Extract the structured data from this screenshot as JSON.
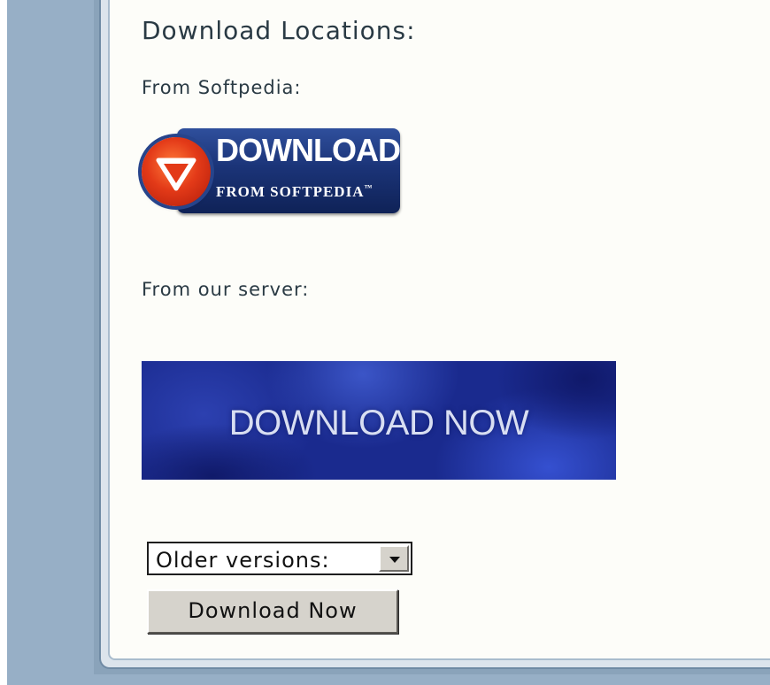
{
  "section": {
    "heading": "Download Locations:",
    "from_softpedia_label": "From Softpedia:",
    "from_server_label": "From our server:"
  },
  "softpedia_badge": {
    "line1": "DOWNLOAD",
    "line2": "FROM SOFTPEDIA",
    "trademark": "™"
  },
  "server_banner": {
    "text": "DOWNLOAD NOW"
  },
  "older_versions": {
    "selected": "Older versions:"
  },
  "download_button": {
    "label": "Download Now"
  },
  "colors": {
    "sidebar": "#97afc6",
    "panel_bg": "#fdfdf9",
    "badge_blue": "#1b3478",
    "badge_red": "#e33a18",
    "banner_blue": "#1a2a8e",
    "button_face": "#d6d3cc"
  },
  "icons": {
    "badge_icon": "down-arrow-circle-icon",
    "select_icon": "chevron-down-icon"
  }
}
